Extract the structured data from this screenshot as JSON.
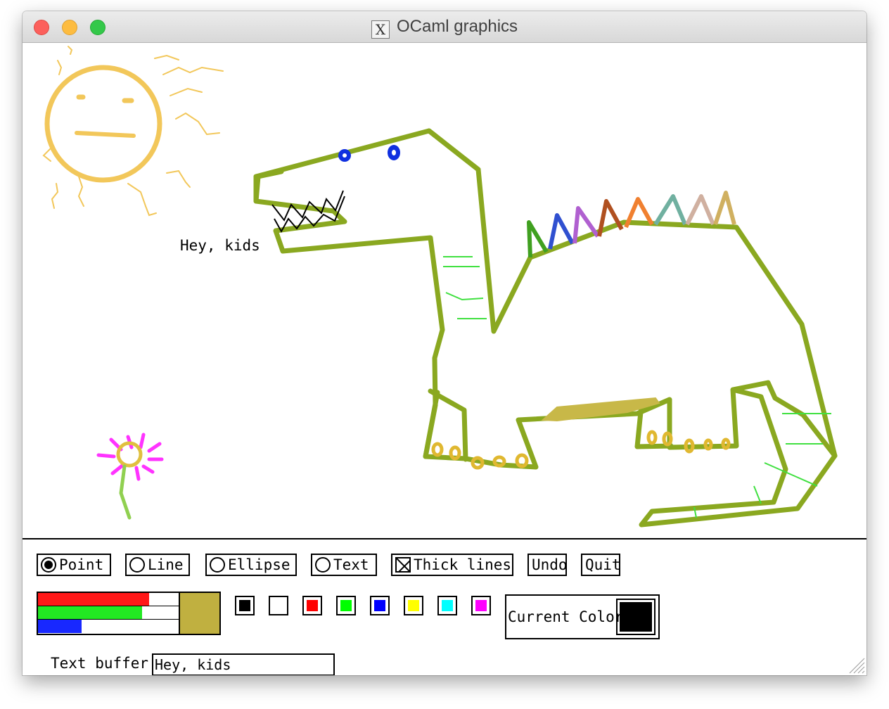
{
  "window": {
    "title": "OCaml graphics",
    "icon": "x11-icon"
  },
  "canvas": {
    "text": "Hey, kids"
  },
  "tools": {
    "point": {
      "label": "Point",
      "selected": true
    },
    "line": {
      "label": "Line",
      "selected": false
    },
    "ellipse": {
      "label": "Ellipse",
      "selected": false
    },
    "text": {
      "label": "Text",
      "selected": false
    },
    "thick_lines": {
      "label": "Thick lines",
      "checked": true
    },
    "undo": {
      "label": "Undo"
    },
    "quit": {
      "label": "Quit"
    }
  },
  "color_sliders": {
    "red": {
      "fraction": 0.79,
      "color": "#ff0000"
    },
    "green": {
      "fraction": 0.74,
      "color": "#00ff00"
    },
    "blue": {
      "fraction": 0.31,
      "color": "#0000ff"
    },
    "mixed_color": "#c0b040"
  },
  "palette": [
    "#000000",
    "#ffffff",
    "#ff0000",
    "#00ff00",
    "#0000ff",
    "#ffff00",
    "#00ffff",
    "#ff00ff"
  ],
  "current_color": {
    "label": "Current Color",
    "value": "#000000"
  },
  "text_buffer": {
    "label": "Text buffer:",
    "value": "Hey, kids"
  }
}
